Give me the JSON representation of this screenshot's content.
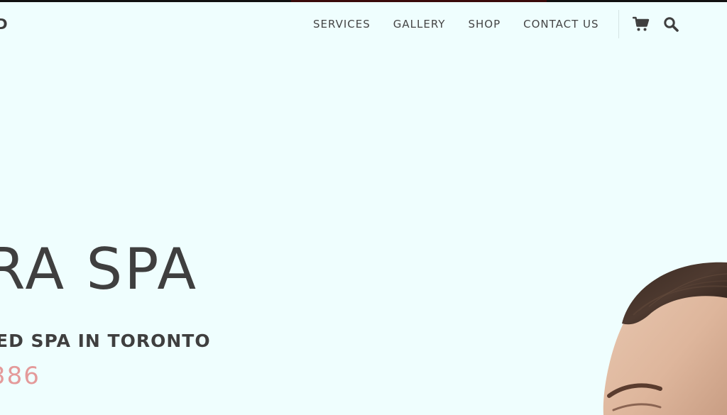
{
  "header": {
    "logo_fragment": "D",
    "nav": [
      {
        "label": "SERVICES"
      },
      {
        "label": "GALLERY"
      },
      {
        "label": "SHOP"
      },
      {
        "label": "CONTACT US"
      }
    ],
    "icons": {
      "cart": "shopping-cart-icon",
      "search": "search-icon"
    }
  },
  "hero": {
    "title": "RA SPA",
    "subtitle": "ED SPA IN TORONTO",
    "phone": "386"
  },
  "colors": {
    "background": "#effefe",
    "text": "#3f3f3f",
    "accent_pink": "#e49a9a"
  }
}
